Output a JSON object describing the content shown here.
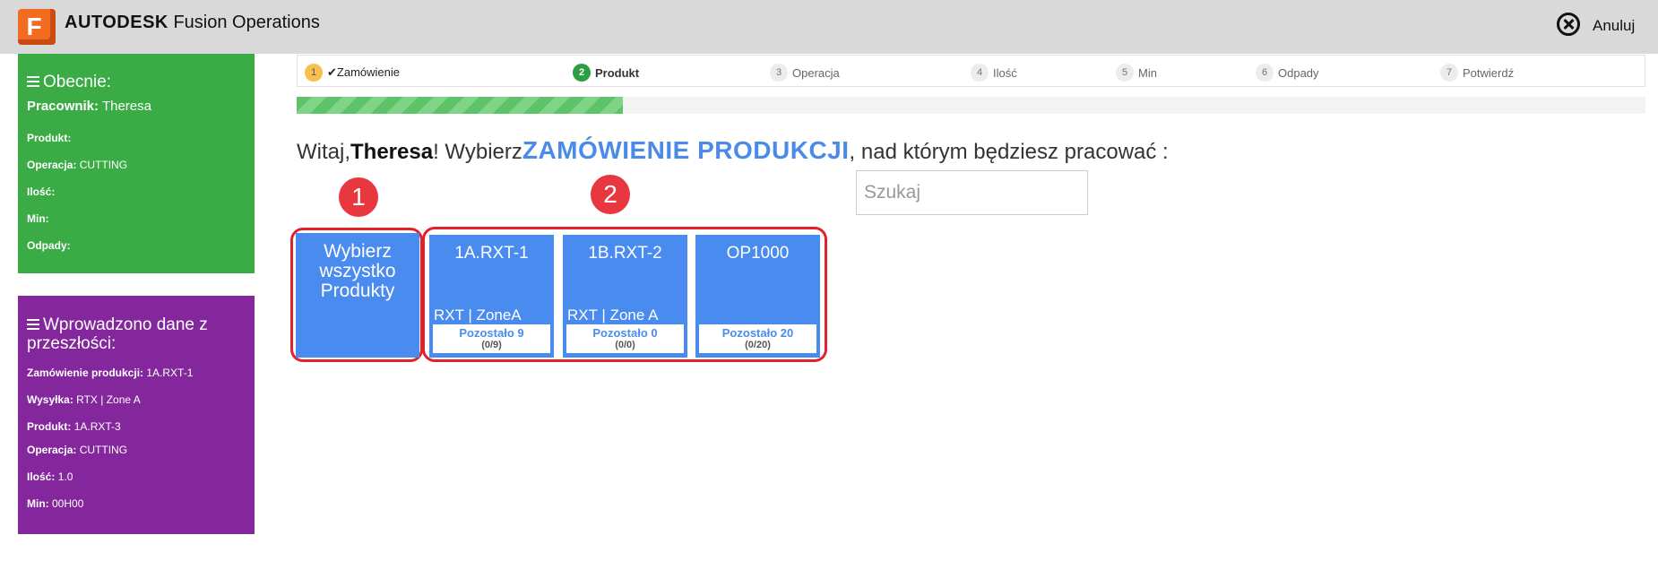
{
  "header": {
    "logo_letter": "F",
    "brand": "AUTODESK",
    "product": "Fusion Operations",
    "cancel_label": "Anuluj"
  },
  "current_panel": {
    "title": "Obecnie:",
    "worker_label": "Pracownik:",
    "worker_value": "Theresa",
    "product_label": "Produkt:",
    "operation_label": "Operacja:",
    "operation_value": "CUTTING",
    "quantity_label": "Ilość:",
    "min_label": "Min:",
    "scrap_label": "Odpady:"
  },
  "history_panel": {
    "title": "Wprowadzono dane z przeszłości:",
    "rows": [
      {
        "label": "Zamówienie produkcji:",
        "value": "1A.RXT-1"
      },
      {
        "label": "Wysyłka:",
        "value": "RTX | Zone A"
      },
      {
        "label": "Produkt:",
        "value": "1A.RXT-3"
      },
      {
        "label": "Operacja:",
        "value": "CUTTING"
      },
      {
        "label": "Ilość:",
        "value": "1.0"
      },
      {
        "label": "Min:",
        "value": "00H00"
      }
    ]
  },
  "steps": [
    {
      "num": "1",
      "label": "✔Zamówienie",
      "state": "done"
    },
    {
      "num": "2",
      "label": "Produkt",
      "state": "active"
    },
    {
      "num": "3",
      "label": "Operacja",
      "state": "pending"
    },
    {
      "num": "4",
      "label": "Ilość",
      "state": "pending"
    },
    {
      "num": "5",
      "label": "Min",
      "state": "pending"
    },
    {
      "num": "6",
      "label": "Odpady",
      "state": "pending"
    },
    {
      "num": "7",
      "label": "Potwierdź",
      "state": "pending"
    }
  ],
  "progress_fraction": 0.242,
  "greeting": {
    "prefix": "Witaj,",
    "name": "Theresa",
    "middle": "! Wybierz",
    "highlight": "ZAMÓWIENIE PRODUKCJI",
    "suffix": ", nad którym będziesz pracować :"
  },
  "search": {
    "placeholder": "Szukaj",
    "value": ""
  },
  "annotations": {
    "badge_1": "1",
    "badge_2": "2"
  },
  "select_all_label": "Wybierz wszystko Produkty",
  "orders": [
    {
      "code": "1A.RXT-1",
      "location": "RXT | ZoneA",
      "remaining": "Pozostało 9",
      "count": "(0/9)"
    },
    {
      "code": "1B.RXT-2",
      "location": "RXT | Zone A",
      "remaining": "Pozostało 0",
      "count": "(0/0)"
    },
    {
      "code": "OP1000",
      "location": "",
      "remaining": "Pozostało 20",
      "count": "(0/20)"
    }
  ],
  "colors": {
    "header_bg": "#d9d9d9",
    "current_panel": "#3aab45",
    "history_panel": "#84279c",
    "tile": "#4a8bef",
    "highlight": "#4a8bea",
    "annotation": "#e0232b"
  }
}
